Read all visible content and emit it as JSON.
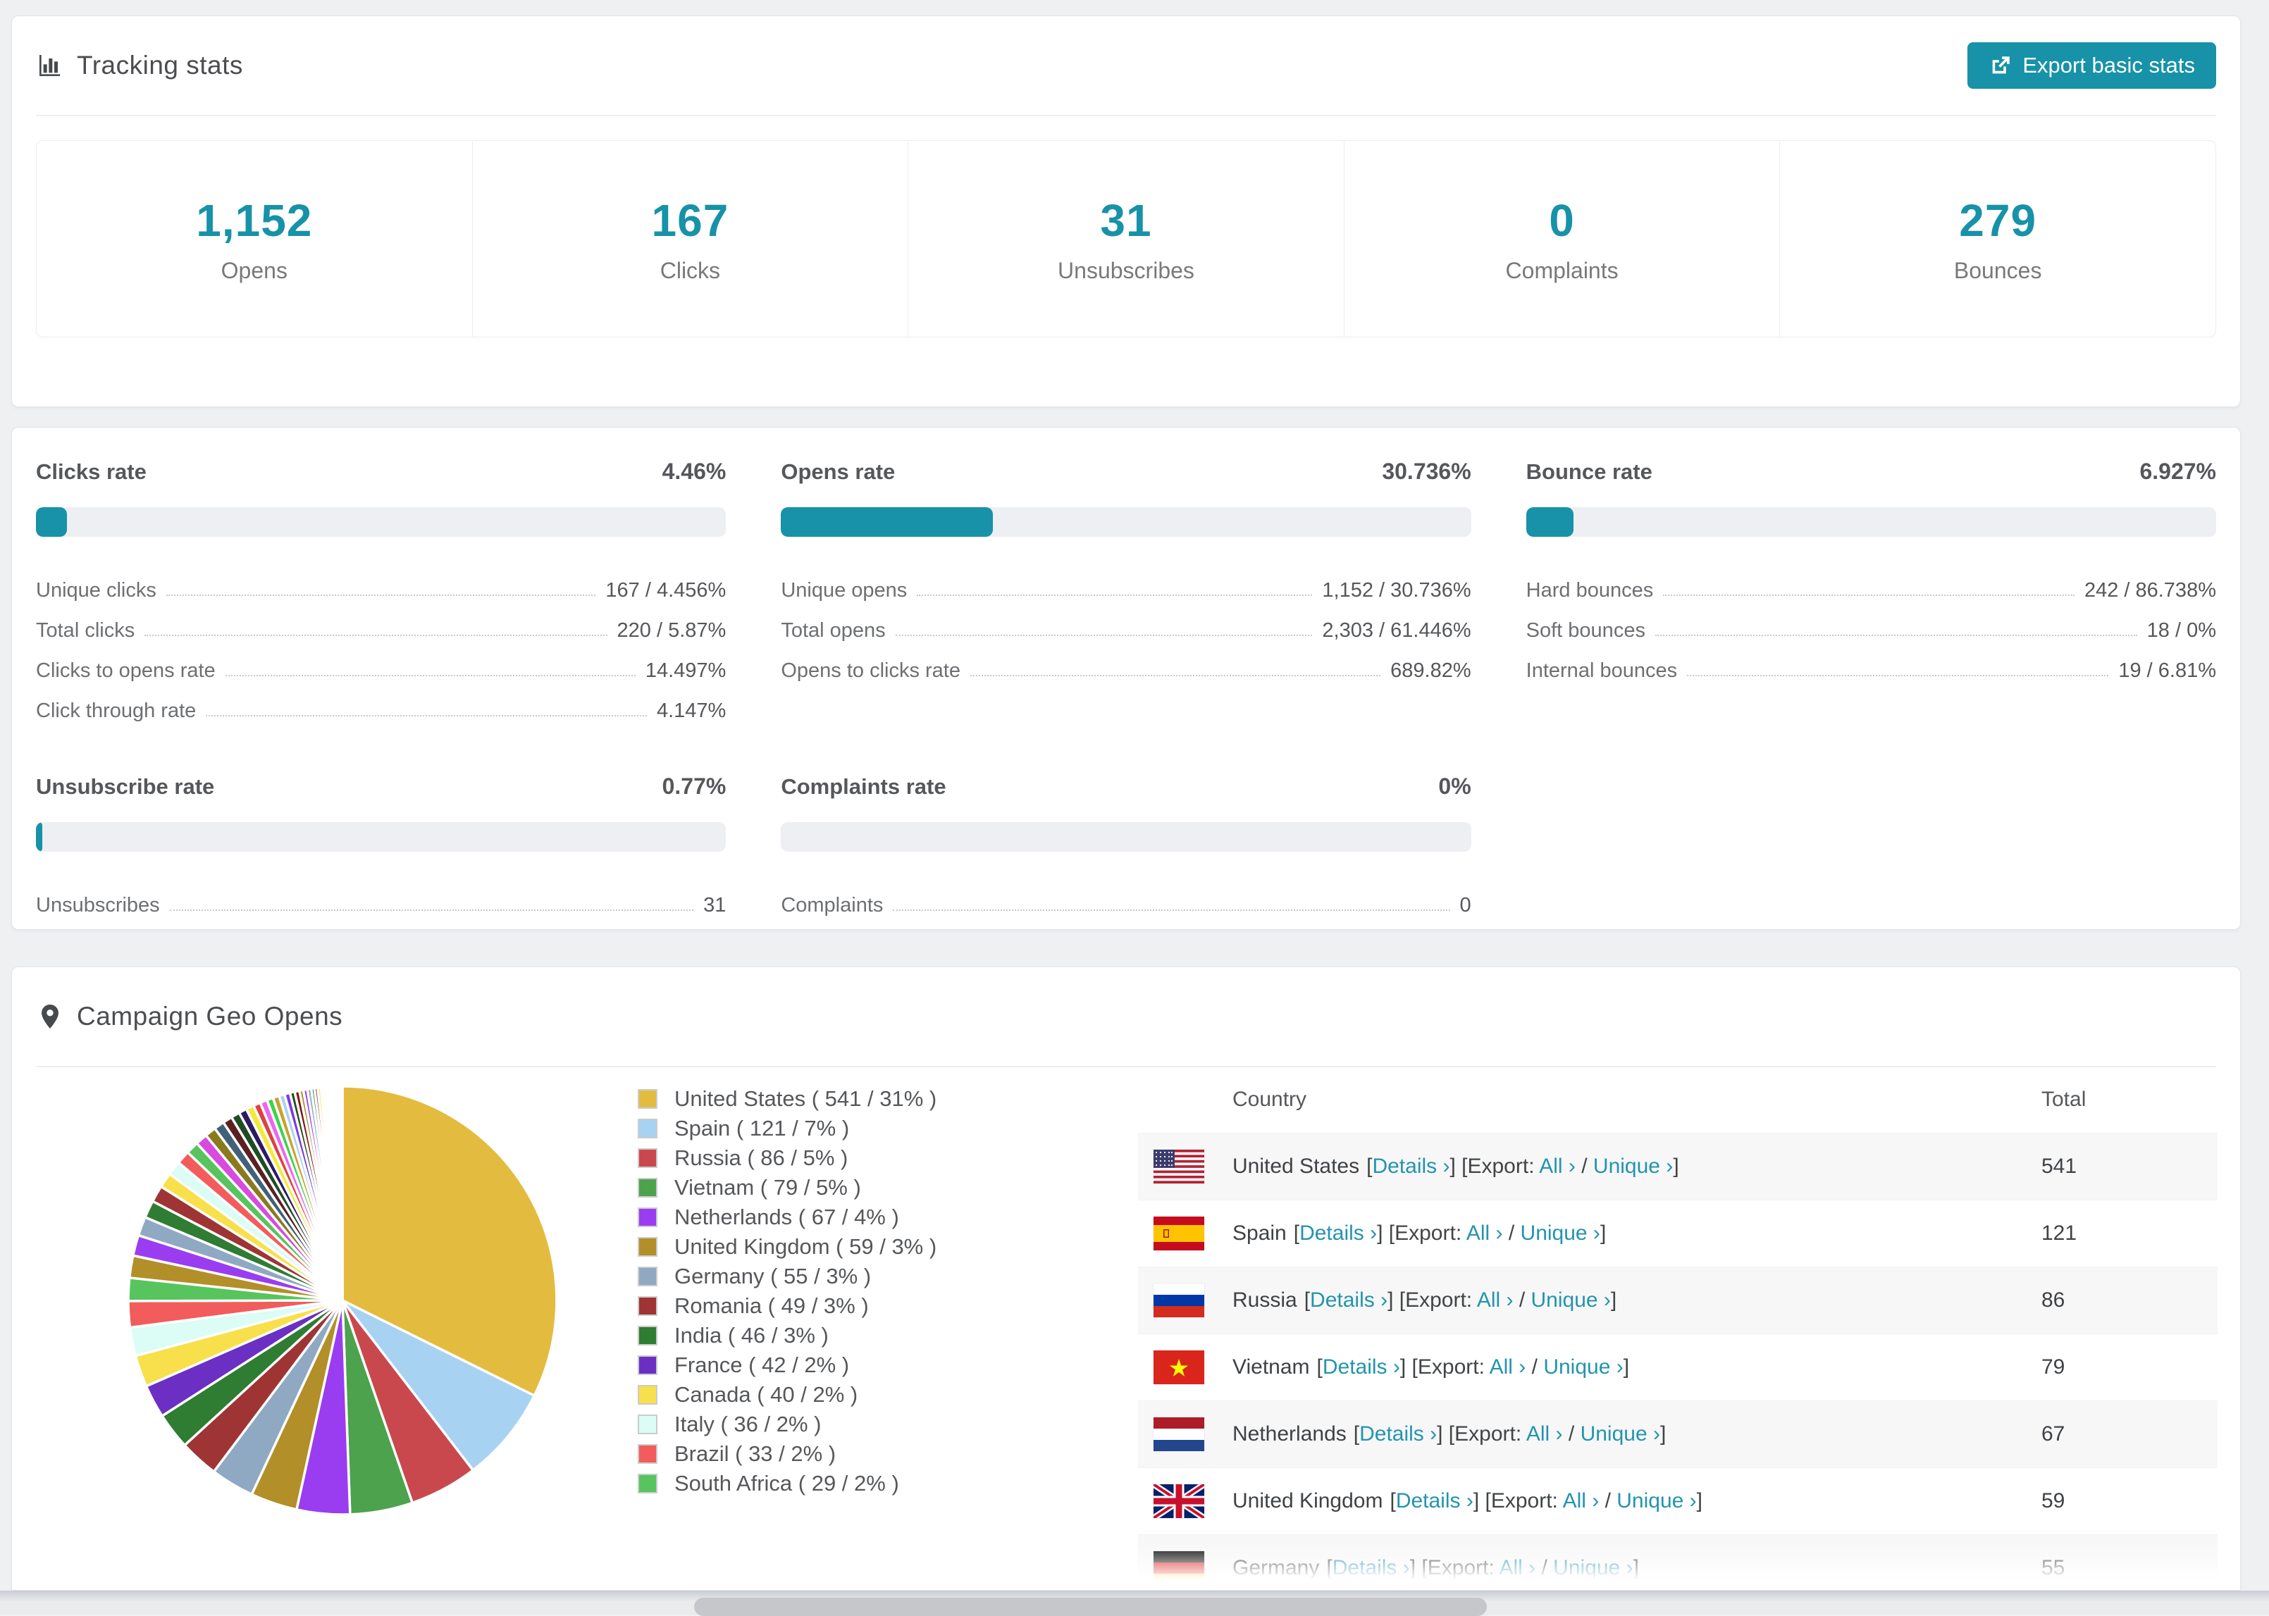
{
  "colors": {
    "accent": "#1792a8",
    "link": "#2394ae"
  },
  "tracking": {
    "title": "Tracking stats",
    "export_label": "Export basic stats",
    "stats": [
      {
        "value": "1,152",
        "label": "Opens"
      },
      {
        "value": "167",
        "label": "Clicks"
      },
      {
        "value": "31",
        "label": "Unsubscribes"
      },
      {
        "value": "0",
        "label": "Complaints"
      },
      {
        "value": "279",
        "label": "Bounces"
      }
    ]
  },
  "rates": [
    {
      "name": "Clicks rate",
      "value": "4.46%",
      "percent": 4.46,
      "rows": [
        [
          "Unique clicks",
          "167 / 4.456%"
        ],
        [
          "Total clicks",
          "220 / 5.87%"
        ],
        [
          "Clicks to opens rate",
          "14.497%"
        ],
        [
          "Click through rate",
          "4.147%"
        ]
      ]
    },
    {
      "name": "Opens rate",
      "value": "30.736%",
      "percent": 30.736,
      "rows": [
        [
          "Unique opens",
          "1,152 / 30.736%"
        ],
        [
          "Total opens",
          "2,303 / 61.446%"
        ],
        [
          "Opens to clicks rate",
          "689.82%"
        ]
      ]
    },
    {
      "name": "Bounce rate",
      "value": "6.927%",
      "percent": 6.927,
      "rows": [
        [
          "Hard bounces",
          "242 / 86.738%"
        ],
        [
          "Soft bounces",
          "18 / 0%"
        ],
        [
          "Internal bounces",
          "19 / 6.81%"
        ]
      ]
    },
    {
      "name": "Unsubscribe rate",
      "value": "0.77%",
      "percent": 0.77,
      "rows": [
        [
          "Unsubscribes",
          "31"
        ]
      ]
    },
    {
      "name": "Complaints rate",
      "value": "0%",
      "percent": 0,
      "rows": [
        [
          "Complaints",
          "0"
        ]
      ]
    }
  ],
  "geo": {
    "title": "Campaign Geo Opens",
    "table": {
      "headers": [
        "Country",
        "Total"
      ],
      "links": {
        "details": "Details ›",
        "export_prefix": "[Export: ",
        "all": "All ›",
        "separator": " / ",
        "unique": "Unique ›",
        "open": "[",
        "close": "]"
      },
      "rows": [
        {
          "flag": "us",
          "country": "United States",
          "total": "541"
        },
        {
          "flag": "es",
          "country": "Spain",
          "total": "121"
        },
        {
          "flag": "ru",
          "country": "Russia",
          "total": "86"
        },
        {
          "flag": "vn",
          "country": "Vietnam",
          "total": "79"
        },
        {
          "flag": "nl",
          "country": "Netherlands",
          "total": "67"
        },
        {
          "flag": "gb",
          "country": "United Kingdom",
          "total": "59"
        },
        {
          "flag": "de",
          "country": "Germany",
          "total": "55"
        }
      ]
    }
  },
  "chart_data": {
    "type": "pie",
    "title": "Campaign Geo Opens",
    "legend_position": "right",
    "series": [
      {
        "name": "United States",
        "value": 541,
        "percent": "31%",
        "color": "#e3bc3f"
      },
      {
        "name": "Spain",
        "value": 121,
        "percent": "7%",
        "color": "#a8d2f2"
      },
      {
        "name": "Russia",
        "value": 86,
        "percent": "5%",
        "color": "#c9484d"
      },
      {
        "name": "Vietnam",
        "value": 79,
        "percent": "5%",
        "color": "#4da24d"
      },
      {
        "name": "Netherlands",
        "value": 67,
        "percent": "4%",
        "color": "#9a3df0"
      },
      {
        "name": "United Kingdom",
        "value": 59,
        "percent": "3%",
        "color": "#b28f28"
      },
      {
        "name": "Germany",
        "value": 55,
        "percent": "3%",
        "color": "#8fa9c2"
      },
      {
        "name": "Romania",
        "value": 49,
        "percent": "3%",
        "color": "#9e3434"
      },
      {
        "name": "India",
        "value": 46,
        "percent": "3%",
        "color": "#2f7c33"
      },
      {
        "name": "France",
        "value": 42,
        "percent": "2%",
        "color": "#6c2fc4"
      },
      {
        "name": "Canada",
        "value": 40,
        "percent": "2%",
        "color": "#f7e04b"
      },
      {
        "name": "Italy",
        "value": 36,
        "percent": "2%",
        "color": "#dcfcf6"
      },
      {
        "name": "Brazil",
        "value": 33,
        "percent": "2%",
        "color": "#f25c5c"
      },
      {
        "name": "South Africa",
        "value": 29,
        "percent": "2%",
        "color": "#57c45e"
      }
    ],
    "other_slices": [
      28,
      26,
      24,
      22,
      21,
      19,
      18,
      17,
      16,
      15,
      14,
      13,
      12,
      11,
      10,
      10,
      9,
      9,
      8,
      8,
      7,
      7,
      6,
      6,
      5,
      5,
      5,
      4,
      4,
      4,
      3,
      3,
      3,
      3,
      2,
      2,
      2,
      2,
      2,
      1,
      1,
      1,
      1,
      1
    ],
    "other_palette": [
      "#b28f28",
      "#9a3df0",
      "#8fa9c2",
      "#2f7c33",
      "#9e3434",
      "#f7e04b",
      "#dcfcf6",
      "#f25c5c",
      "#57c45e",
      "#d84ae0",
      "#8a7a1e",
      "#41617a",
      "#5c2020",
      "#1e4d25",
      "#2c1a66",
      "#f2ea3a",
      "#e04040",
      "#ee66ee",
      "#3ad44a",
      "#c9a22e",
      "#a8d2f2",
      "#7a3ce0",
      "#274e13",
      "#801818"
    ]
  }
}
